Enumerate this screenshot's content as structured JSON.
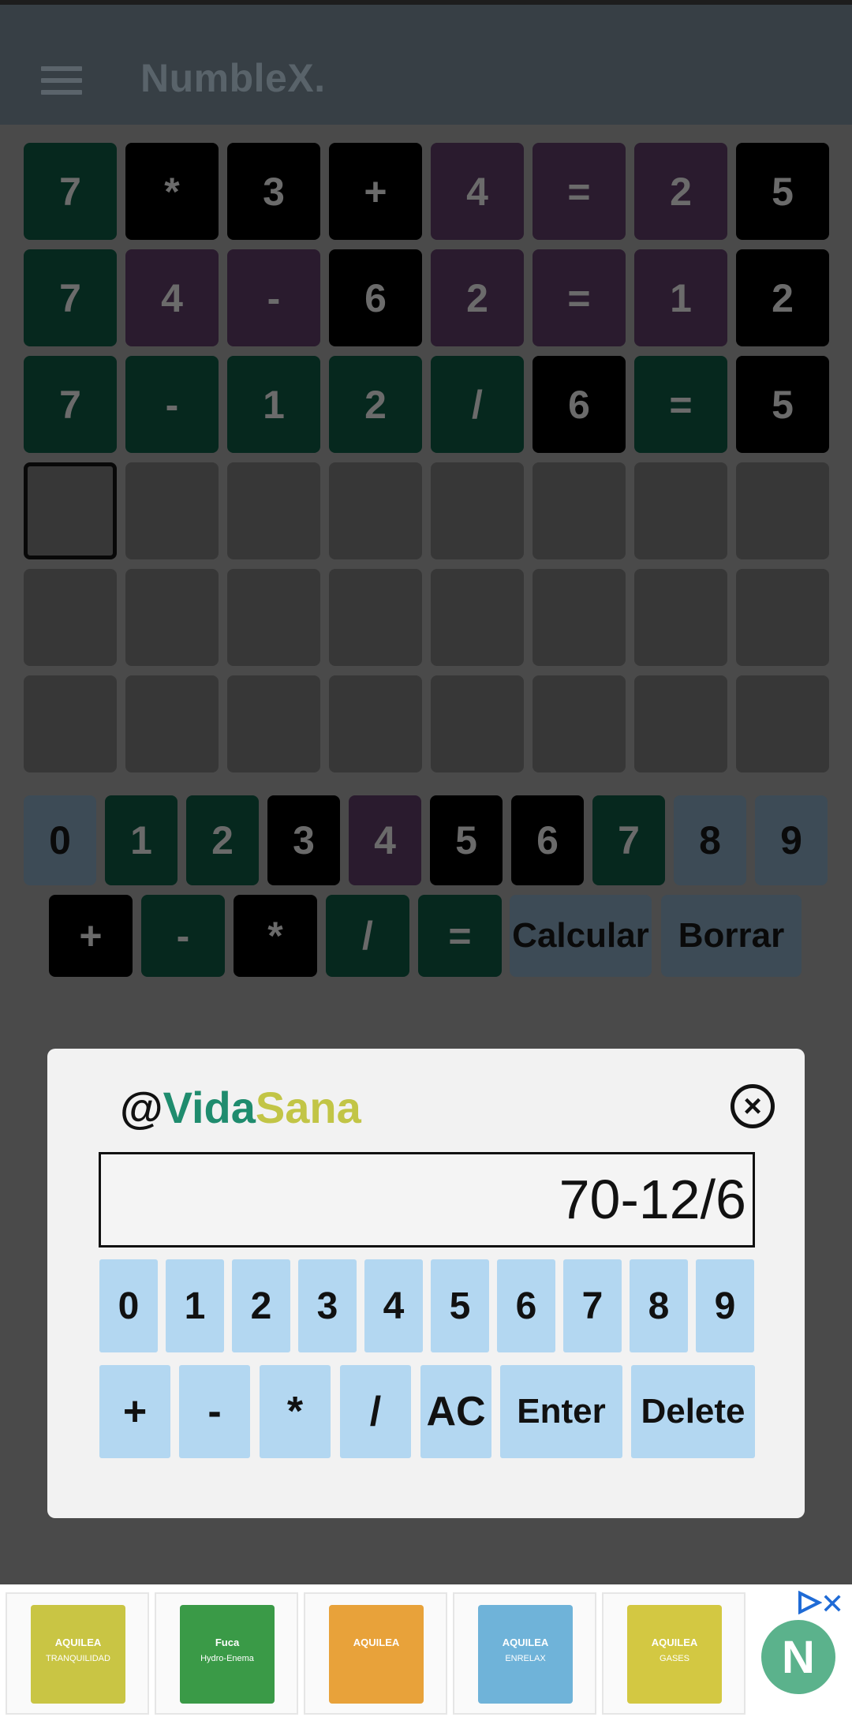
{
  "app": {
    "title": "NumbleX."
  },
  "board": {
    "rows": [
      [
        {
          "v": "7",
          "s": "green"
        },
        {
          "v": "*",
          "s": "black"
        },
        {
          "v": "3",
          "s": "black"
        },
        {
          "v": "+",
          "s": "black"
        },
        {
          "v": "4",
          "s": "purple"
        },
        {
          "v": "=",
          "s": "purple"
        },
        {
          "v": "2",
          "s": "purple"
        },
        {
          "v": "5",
          "s": "black"
        }
      ],
      [
        {
          "v": "7",
          "s": "green"
        },
        {
          "v": "4",
          "s": "purple"
        },
        {
          "v": "-",
          "s": "purple"
        },
        {
          "v": "6",
          "s": "black"
        },
        {
          "v": "2",
          "s": "purple"
        },
        {
          "v": "=",
          "s": "purple"
        },
        {
          "v": "1",
          "s": "purple"
        },
        {
          "v": "2",
          "s": "black"
        }
      ],
      [
        {
          "v": "7",
          "s": "green"
        },
        {
          "v": "-",
          "s": "green"
        },
        {
          "v": "1",
          "s": "green"
        },
        {
          "v": "2",
          "s": "green"
        },
        {
          "v": "/",
          "s": "green"
        },
        {
          "v": "6",
          "s": "black"
        },
        {
          "v": "=",
          "s": "green"
        },
        {
          "v": "5",
          "s": "black"
        }
      ],
      [
        {
          "v": "",
          "s": "active"
        },
        {
          "v": "",
          "s": "empty"
        },
        {
          "v": "",
          "s": "empty"
        },
        {
          "v": "",
          "s": "empty"
        },
        {
          "v": "",
          "s": "empty"
        },
        {
          "v": "",
          "s": "empty"
        },
        {
          "v": "",
          "s": "empty"
        },
        {
          "v": "",
          "s": "empty"
        }
      ],
      [
        {
          "v": "",
          "s": "empty"
        },
        {
          "v": "",
          "s": "empty"
        },
        {
          "v": "",
          "s": "empty"
        },
        {
          "v": "",
          "s": "empty"
        },
        {
          "v": "",
          "s": "empty"
        },
        {
          "v": "",
          "s": "empty"
        },
        {
          "v": "",
          "s": "empty"
        },
        {
          "v": "",
          "s": "empty"
        }
      ],
      [
        {
          "v": "",
          "s": "empty"
        },
        {
          "v": "",
          "s": "empty"
        },
        {
          "v": "",
          "s": "empty"
        },
        {
          "v": "",
          "s": "empty"
        },
        {
          "v": "",
          "s": "empty"
        },
        {
          "v": "",
          "s": "empty"
        },
        {
          "v": "",
          "s": "empty"
        },
        {
          "v": "",
          "s": "empty"
        }
      ]
    ]
  },
  "keyboard": {
    "digits": [
      {
        "label": "0",
        "s": "grey"
      },
      {
        "label": "1",
        "s": "green"
      },
      {
        "label": "2",
        "s": "green"
      },
      {
        "label": "3",
        "s": "black"
      },
      {
        "label": "4",
        "s": "purple"
      },
      {
        "label": "5",
        "s": "black"
      },
      {
        "label": "6",
        "s": "black"
      },
      {
        "label": "7",
        "s": "green"
      },
      {
        "label": "8",
        "s": "grey"
      },
      {
        "label": "9",
        "s": "grey"
      }
    ],
    "ops": [
      {
        "label": "+",
        "s": "black"
      },
      {
        "label": "-",
        "s": "green"
      },
      {
        "label": "*",
        "s": "black"
      },
      {
        "label": "/",
        "s": "green"
      },
      {
        "label": "=",
        "s": "green"
      }
    ],
    "calcular_label": "Calcular",
    "borrar_label": "Borrar"
  },
  "dialog": {
    "brand_at": "@",
    "brand_vida": "Vida",
    "brand_sana": "Sana",
    "close_glyph": "×",
    "expression": "70-12/6",
    "digits": [
      "0",
      "1",
      "2",
      "3",
      "4",
      "5",
      "6",
      "7",
      "8",
      "9"
    ],
    "ops": [
      "+",
      "-",
      "*",
      "/",
      "AC"
    ],
    "enter_label": "Enter",
    "delete_label": "Delete"
  },
  "ad": {
    "close_glyph": "✕",
    "badge_letter": "N",
    "products": [
      {
        "brand": "AQUILEA",
        "name": "TRANQUILIDAD",
        "color": "#c9c544"
      },
      {
        "brand": "Fuca",
        "name": "Hydro-Enema",
        "color": "#3a9a47"
      },
      {
        "brand": "AQUILEA",
        "name": "",
        "color": "#e8a23a"
      },
      {
        "brand": "AQUILEA",
        "name": "ENRELAX",
        "color": "#6fb3d9"
      },
      {
        "brand": "AQUILEA",
        "name": "GASES",
        "color": "#d3c842"
      }
    ]
  }
}
